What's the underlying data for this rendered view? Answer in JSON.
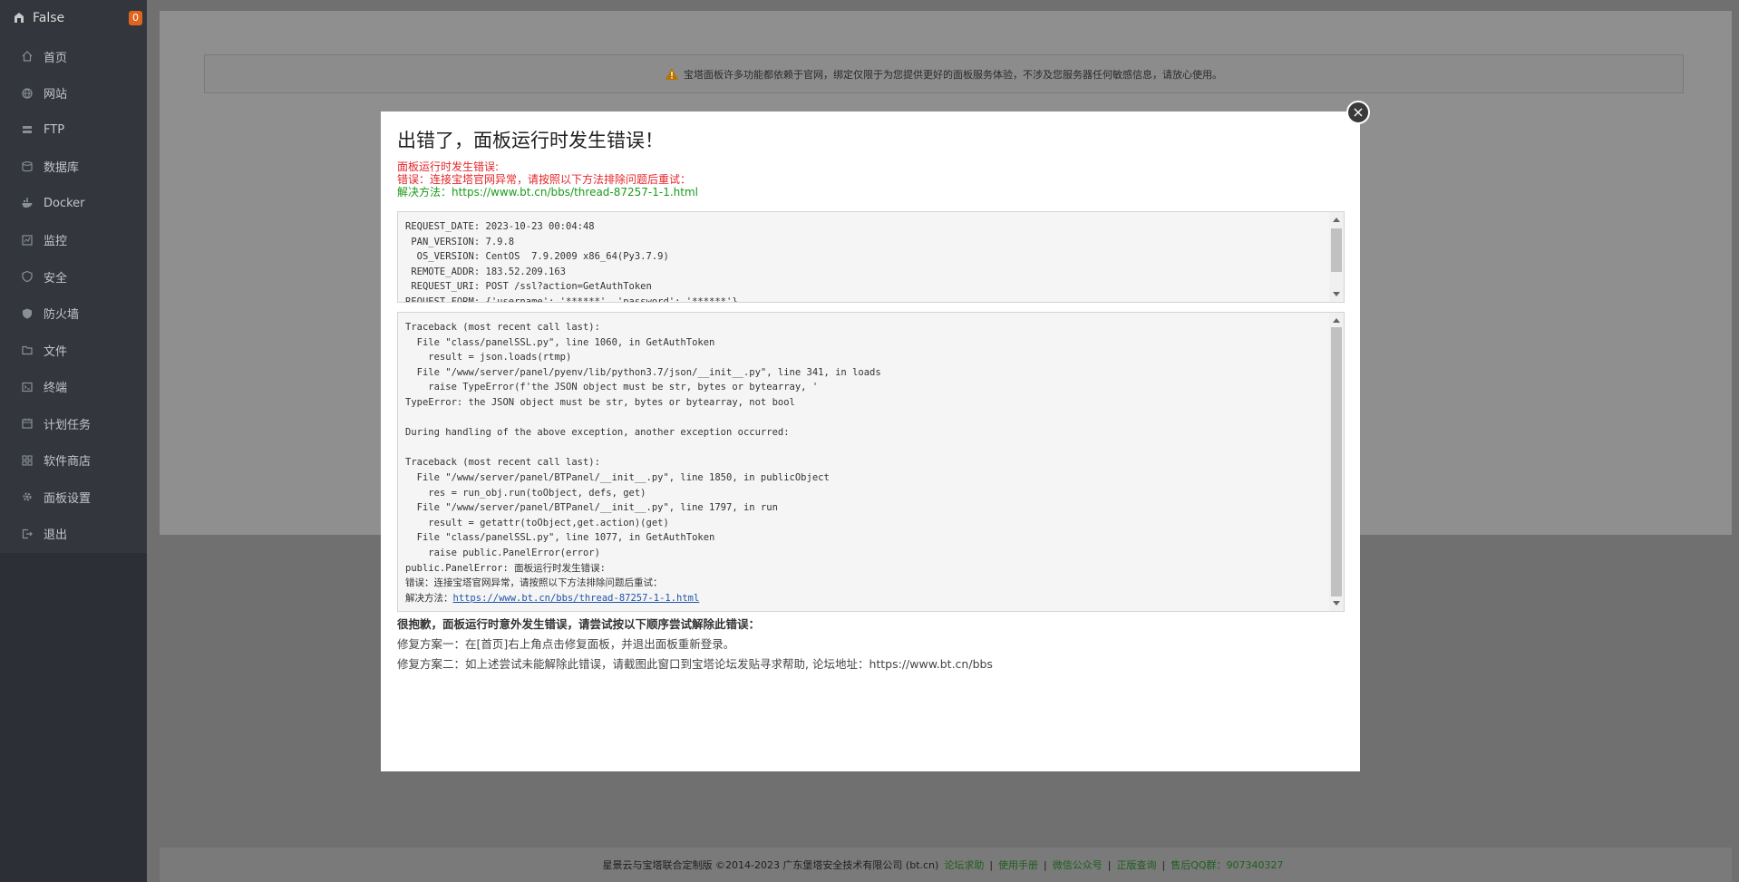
{
  "sidebar": {
    "brand": "False",
    "badge": "0",
    "items": [
      {
        "label": "首页",
        "icon": "home-icon"
      },
      {
        "label": "网站",
        "icon": "globe-icon"
      },
      {
        "label": "FTP",
        "icon": "ftp-icon"
      },
      {
        "label": "数据库",
        "icon": "database-icon"
      },
      {
        "label": "Docker",
        "icon": "docker-icon"
      },
      {
        "label": "监控",
        "icon": "monitor-icon"
      },
      {
        "label": "安全",
        "icon": "shield-icon"
      },
      {
        "label": "防火墙",
        "icon": "firewall-icon"
      },
      {
        "label": "文件",
        "icon": "folder-icon"
      },
      {
        "label": "终端",
        "icon": "terminal-icon"
      },
      {
        "label": "计划任务",
        "icon": "calendar-icon"
      },
      {
        "label": "软件商店",
        "icon": "grid-icon"
      },
      {
        "label": "面板设置",
        "icon": "gear-icon"
      },
      {
        "label": "退出",
        "icon": "logout-icon"
      }
    ]
  },
  "notice": "宝塔面板许多功能都依赖于官网，绑定仅限于为您提供更好的面板服务体验，不涉及您服务器任何敏感信息，请放心使用。",
  "modal": {
    "close": "×",
    "title": "出错了，面板运行时发生错误！",
    "err1": "面板运行时发生错误:",
    "err2": "错误：连接宝塔官网异常，请按照以下方法排除问题后重试：",
    "err3": "解决方法：https://www.bt.cn/bbs/thread-87257-1-1.html",
    "request_lines": [
      "REQUEST_DATE: 2023-10-23 00:04:48",
      " PAN_VERSION: 7.9.8",
      "  OS_VERSION: CentOS  7.9.2009 x86_64(Py3.7.9)",
      " REMOTE_ADDR: 183.52.209.163",
      " REQUEST_URI: POST /ssl?action=GetAuthToken",
      "REQUEST_FORM: {'username': '******', 'password': '******'}"
    ],
    "traceback_lines": [
      "Traceback (most recent call last):",
      "  File \"class/panelSSL.py\", line 1060, in GetAuthToken",
      "    result = json.loads(rtmp)",
      "  File \"/www/server/panel/pyenv/lib/python3.7/json/__init__.py\", line 341, in loads",
      "    raise TypeError(f'the JSON object must be str, bytes or bytearray, '",
      "TypeError: the JSON object must be str, bytes or bytearray, not bool",
      "",
      "During handling of the above exception, another exception occurred:",
      "",
      "Traceback (most recent call last):",
      "  File \"/www/server/panel/BTPanel/__init__.py\", line 1850, in publicObject",
      "    res = run_obj.run(toObject, defs, get)",
      "  File \"/www/server/panel/BTPanel/__init__.py\", line 1797, in run",
      "    result = getattr(toObject,get.action)(get)",
      "  File \"class/panelSSL.py\", line 1077, in GetAuthToken",
      "    raise public.PanelError(error)",
      "public.PanelError: 面板运行时发生错误:",
      "错误：连接宝塔官网异常，请按照以下方法排除问题后重试："
    ],
    "solution_prefix": "解决方法：",
    "solution_link": "https://www.bt.cn/bbs/thread-87257-1-1.html",
    "apology": "很抱歉，面板运行时意外发生错误，请尝试按以下顺序尝试解除此错误：",
    "fix1": "修复方案一：在[首页]右上角点击修复面板，并退出面板重新登录。",
    "fix2": "修复方案二：如上述尝试未能解除此错误，请截图此窗口到宝塔论坛发贴寻求帮助, 论坛地址：https://www.bt.cn/bbs"
  },
  "footer": {
    "copyright": "星景云与宝塔联合定制版 ©2014-2023 广东堡塔安全技术有限公司 (bt.cn)",
    "links": [
      "论坛求助",
      "使用手册",
      "微信公众号",
      "正版查询",
      "售后QQ群：907340327"
    ]
  }
}
